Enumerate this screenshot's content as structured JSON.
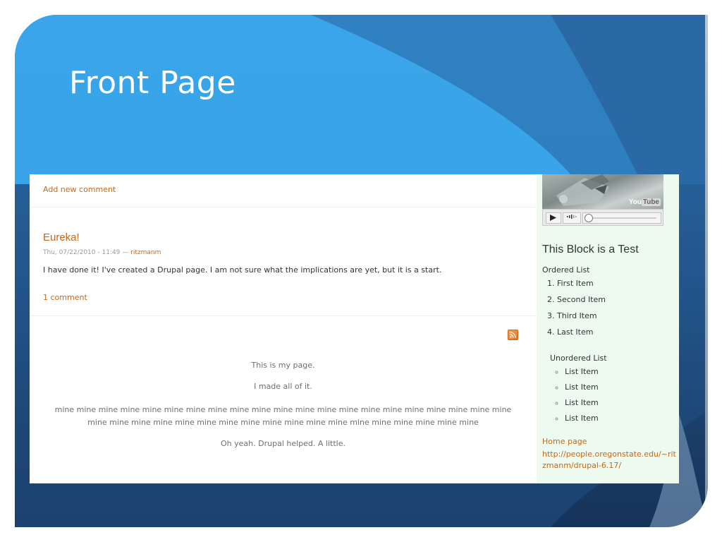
{
  "slide": {
    "title": "Front Page"
  },
  "page": {
    "add_comment": "Add new comment",
    "node": {
      "title": "Eureka!",
      "date": "Thu, 07/22/2010 - 11:49",
      "separator": " — ",
      "author": "ritzmanm",
      "body": "I have done it! I've created a Drupal page. I am not sure what the implications are yet, but it is a start.",
      "comments_link": "1 comment"
    },
    "feed_icon": "rss-feed-icon",
    "text": {
      "p1": "This is my page.",
      "p2": "I made all of it.",
      "p3": "mine mine mine mine mine mine mine mine mine mine mine mine mine mine mine mine mine mine mine mine mine mine mine mine mine mine mine mine mine mine mine mine mine mine mine mine mine mine mine",
      "p4": "Oh yeah. Drupal helped. A little."
    }
  },
  "sidebar": {
    "video": {
      "logo_you": "You",
      "logo_tube": "Tube",
      "play_icon": "play-icon",
      "volume_icon": "volume-icon"
    },
    "block_title": "This Block is a Test",
    "ordered_label": "Ordered List",
    "ordered_items": [
      "First Item",
      "Second Item",
      "Third Item",
      "Last Item"
    ],
    "unordered_label": "Unordered List",
    "unordered_items": [
      "List Item",
      "List Item",
      "List Item",
      "List Item"
    ],
    "home_label": "Home page",
    "home_url": "http://people.oregonstate.edu/~ritzmanm/drupal-6.17/"
  },
  "colors": {
    "link": "#c3681b",
    "sidebar_bg": "#ecfaef",
    "slide_blue": "#3a9fe6"
  }
}
